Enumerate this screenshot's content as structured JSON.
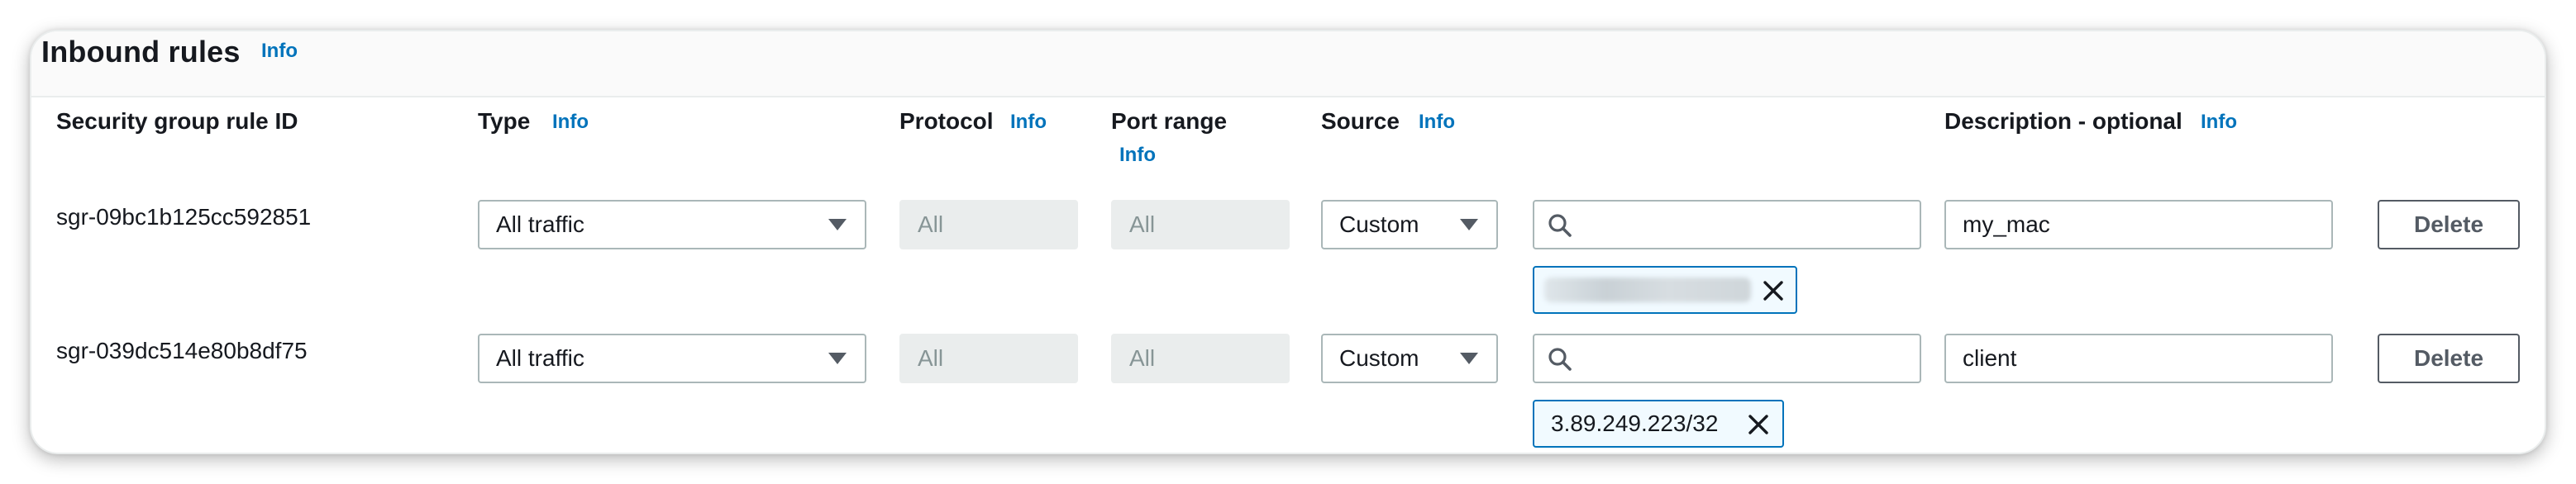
{
  "section": {
    "title": "Inbound rules",
    "info_label": "Info"
  },
  "columns": {
    "rule_id": "Security group rule ID",
    "type": "Type",
    "protocol": "Protocol",
    "port_range": "Port range",
    "source": "Source",
    "description": "Description - optional",
    "info_label": "Info"
  },
  "rules": [
    {
      "rule_id": "sgr-09bc1b125cc592851",
      "type": "All traffic",
      "protocol": "All",
      "port_range": "All",
      "source_type": "Custom",
      "source_search": "",
      "source_token": "",
      "source_token_redacted": true,
      "description": "my_mac",
      "delete_label": "Delete"
    },
    {
      "rule_id": "sgr-039dc514e80b8df75",
      "type": "All traffic",
      "protocol": "All",
      "port_range": "All",
      "source_type": "Custom",
      "source_search": "",
      "source_token": "3.89.249.223/32",
      "source_token_redacted": false,
      "description": "client",
      "delete_label": "Delete"
    }
  ],
  "icons": {
    "search": "search-icon",
    "dropdown": "caret-down-icon",
    "remove": "close-icon"
  },
  "colors": {
    "link": "#0073bb",
    "token_border": "#0073bb",
    "token_bg": "#f1faff",
    "disabled_bg": "#eaeded",
    "input_border": "#aab7b8"
  }
}
